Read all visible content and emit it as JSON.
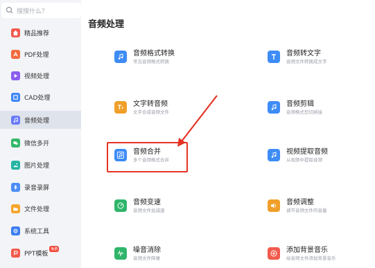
{
  "search": {
    "placeholder": "搜搜什么？"
  },
  "sidebar": {
    "items": [
      {
        "label": "精品推荐",
        "icon": "home-icon",
        "color": "#f15b4d"
      },
      {
        "label": "PDF处理",
        "icon": "pdf-icon",
        "color": "#f26a3c"
      },
      {
        "label": "视频处理",
        "icon": "video-icon",
        "color": "#8a5cf0"
      },
      {
        "label": "CAD处理",
        "icon": "cad-icon",
        "color": "#3f86f5"
      },
      {
        "label": "音频处理",
        "icon": "audio-icon",
        "color": "#6a7cf6"
      },
      {
        "label": "微信多开",
        "icon": "wechat-icon",
        "color": "#34b86a"
      },
      {
        "label": "图片处理",
        "icon": "image-icon",
        "color": "#25b5a3"
      },
      {
        "label": "录音录屏",
        "icon": "microphone-icon",
        "color": "#4c8df5"
      },
      {
        "label": "文件处理",
        "icon": "folder-icon",
        "color": "#f4a52a"
      },
      {
        "label": "系统工具",
        "icon": "gear-icon",
        "color": "#3c7ef0"
      },
      {
        "label": "PPT模板",
        "icon": "ppt-icon",
        "color": "#f15b4d",
        "badge": "免费"
      }
    ],
    "active_index": 4
  },
  "main": {
    "title": "音频处理",
    "tools": [
      {
        "name": "音频格式转换",
        "desc": "常见音频格式转换",
        "icon": "audio-convert-icon",
        "color": "#3e8cf6"
      },
      {
        "name": "音频转文字",
        "desc": "音频文件转换成文字",
        "icon": "audio-to-text-icon",
        "color": "#3e8cf6"
      },
      {
        "name": "文字转音频",
        "desc": "文字合成音频文件",
        "icon": "text-to-audio-icon",
        "color": "#f0a02a"
      },
      {
        "name": "音频剪辑",
        "desc": "音频格式剪切拼接",
        "icon": "audio-cut-icon",
        "color": "#3e8cf6"
      },
      {
        "name": "音频合并",
        "desc": "多个音频格式合并",
        "icon": "audio-merge-icon",
        "color": "#3e8cf6"
      },
      {
        "name": "视频提取音频",
        "desc": "从视频中提取音频",
        "icon": "video-extract-audio-icon",
        "color": "#3e8cf6"
      },
      {
        "name": "音频变速",
        "desc": "音频文件加减速",
        "icon": "audio-speed-icon",
        "color": "#2fb56a"
      },
      {
        "name": "音频调整",
        "desc": "调节音频文件的音量",
        "icon": "audio-volume-icon",
        "color": "#f0a02a"
      },
      {
        "name": "噪音消除",
        "desc": "音频文件降噪",
        "icon": "noise-reduce-icon",
        "color": "#2fb56a"
      },
      {
        "name": "添加背景音乐",
        "desc": "给音频文件添加背景音乐",
        "icon": "add-bgm-icon",
        "color": "#f15b4d"
      }
    ]
  }
}
